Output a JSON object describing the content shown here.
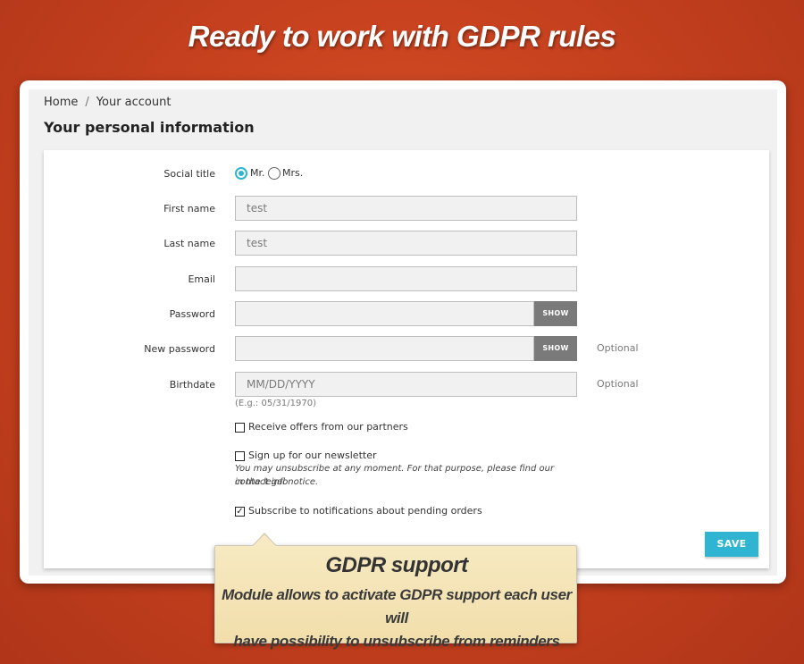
{
  "banner": {
    "title": "Ready to work with GDPR rules"
  },
  "breadcrumb": {
    "home": "Home",
    "separator": "/",
    "current": "Your account"
  },
  "page": {
    "title": "Your personal information"
  },
  "form": {
    "social_title": {
      "label": "Social title",
      "options": [
        "Mr.",
        "Mrs."
      ],
      "selected": "Mr."
    },
    "first_name": {
      "label": "First name",
      "value": "test"
    },
    "last_name": {
      "label": "Last name",
      "value": "test"
    },
    "email": {
      "label": "Email",
      "value": ""
    },
    "password": {
      "label": "Password",
      "value": "",
      "show_label": "SHOW"
    },
    "new_password": {
      "label": "New password",
      "value": "",
      "show_label": "SHOW",
      "optional": "Optional"
    },
    "birthdate": {
      "label": "Birthdate",
      "placeholder": "MM/DD/YYYY",
      "hint": "(E.g.: 05/31/1970)",
      "optional": "Optional"
    },
    "partners_offers": {
      "label": "Receive offers from our partners",
      "checked": false
    },
    "newsletter": {
      "label": "Sign up for our newsletter",
      "checked": false,
      "note_line1": "You may unsubscribe at any moment. For that purpose, please find our contact info",
      "note_line2": "in the legal notice."
    },
    "pending_orders": {
      "label": "Subscribe to notifications about pending orders",
      "checked": true
    },
    "save_label": "SAVE"
  },
  "callout": {
    "title": "GDPR support",
    "line1": "Module allows to activate GDPR support each user will",
    "line2": "have possibility to unsubscribe from reminders"
  },
  "colors": {
    "accent": "#2fb5d2",
    "background": "#c8421f",
    "callout": "#f3e3b4"
  }
}
